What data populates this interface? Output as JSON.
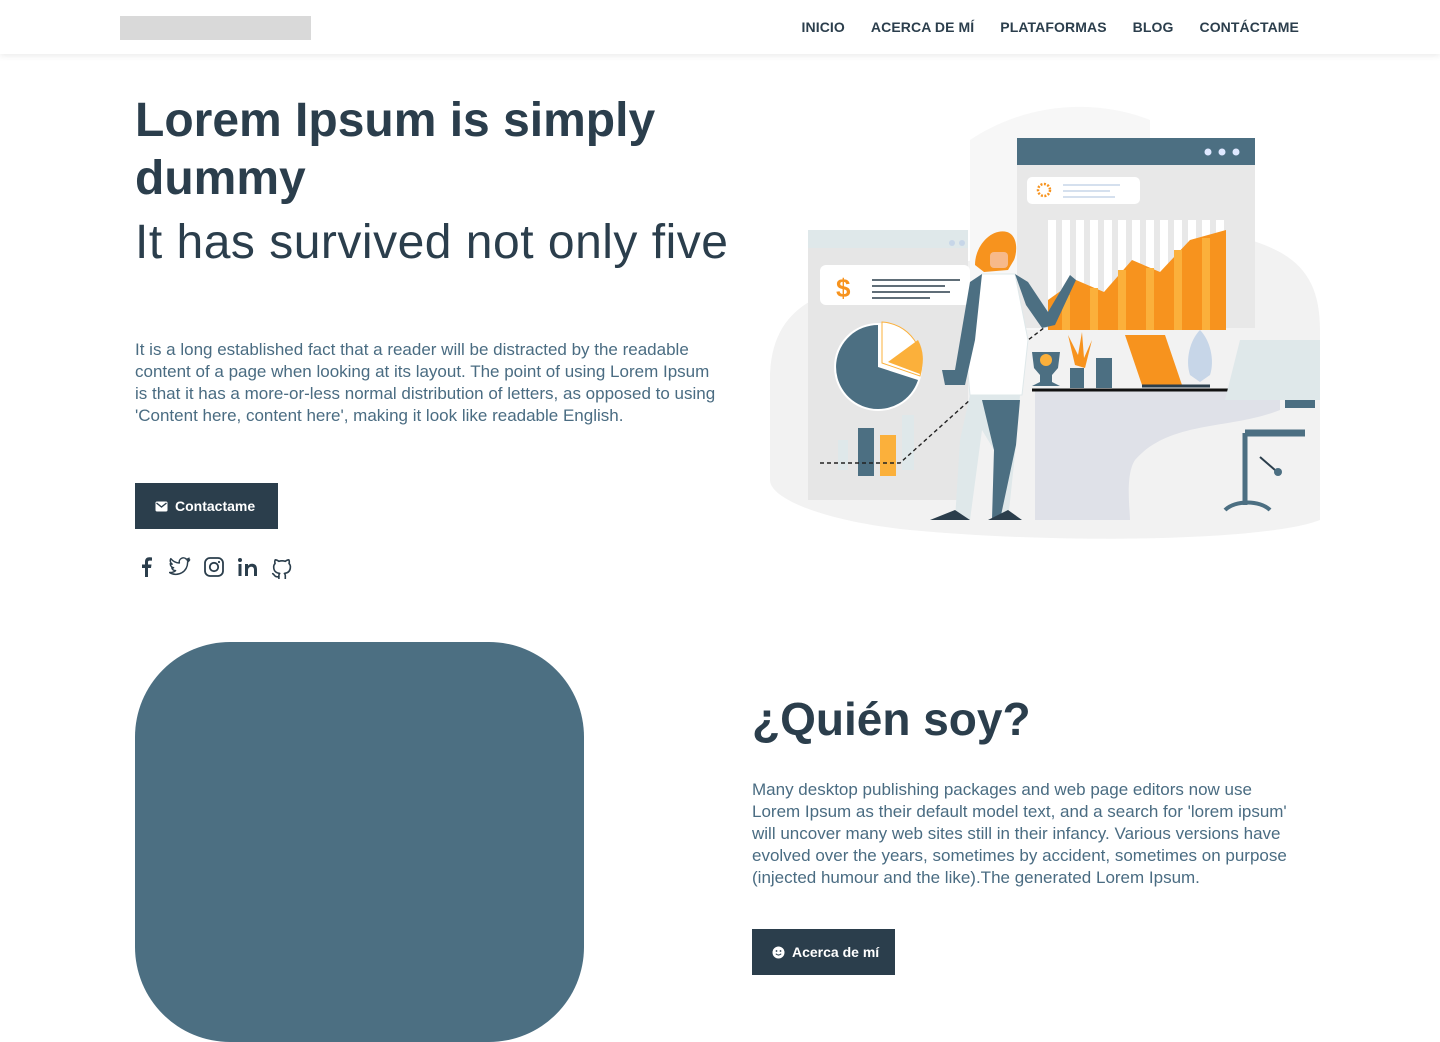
{
  "nav": {
    "items": [
      {
        "label": "INICIO"
      },
      {
        "label": "ACERCA DE MÍ"
      },
      {
        "label": "PLATAFORMAS"
      },
      {
        "label": "BLOG"
      },
      {
        "label": "CONTÁCTAME"
      }
    ]
  },
  "hero": {
    "title": "Lorem Ipsum is simply dummy",
    "subtitle": "It has survived not only five",
    "text": "It is a long established fact that a reader will be distracted by the readable content of a page when looking at its layout. The point of using Lorem Ipsum is that it has a more-or-less normal distribution of letters, as opposed to using 'Content here, content here', making it look like readable English.",
    "button_label": "Contactame",
    "socials": [
      "facebook-icon",
      "twitter-icon",
      "instagram-icon",
      "linkedin-icon",
      "github-icon"
    ]
  },
  "about": {
    "title": "¿Quién soy?",
    "text": "Many desktop publishing packages and web page editors now use Lorem Ipsum as their default model text, and a search for 'lorem ipsum' will uncover many web sites still in their infancy. Various versions have evolved over the years, sometimes by accident, sometimes on purpose (injected humour and the like).The generated Lorem Ipsum.",
    "button_label": "Acerca de mí"
  },
  "colors": {
    "primary": "#2b3e4c",
    "accent": "#4c6f82",
    "orange": "#f7931e",
    "yellow": "#fbb03b"
  }
}
